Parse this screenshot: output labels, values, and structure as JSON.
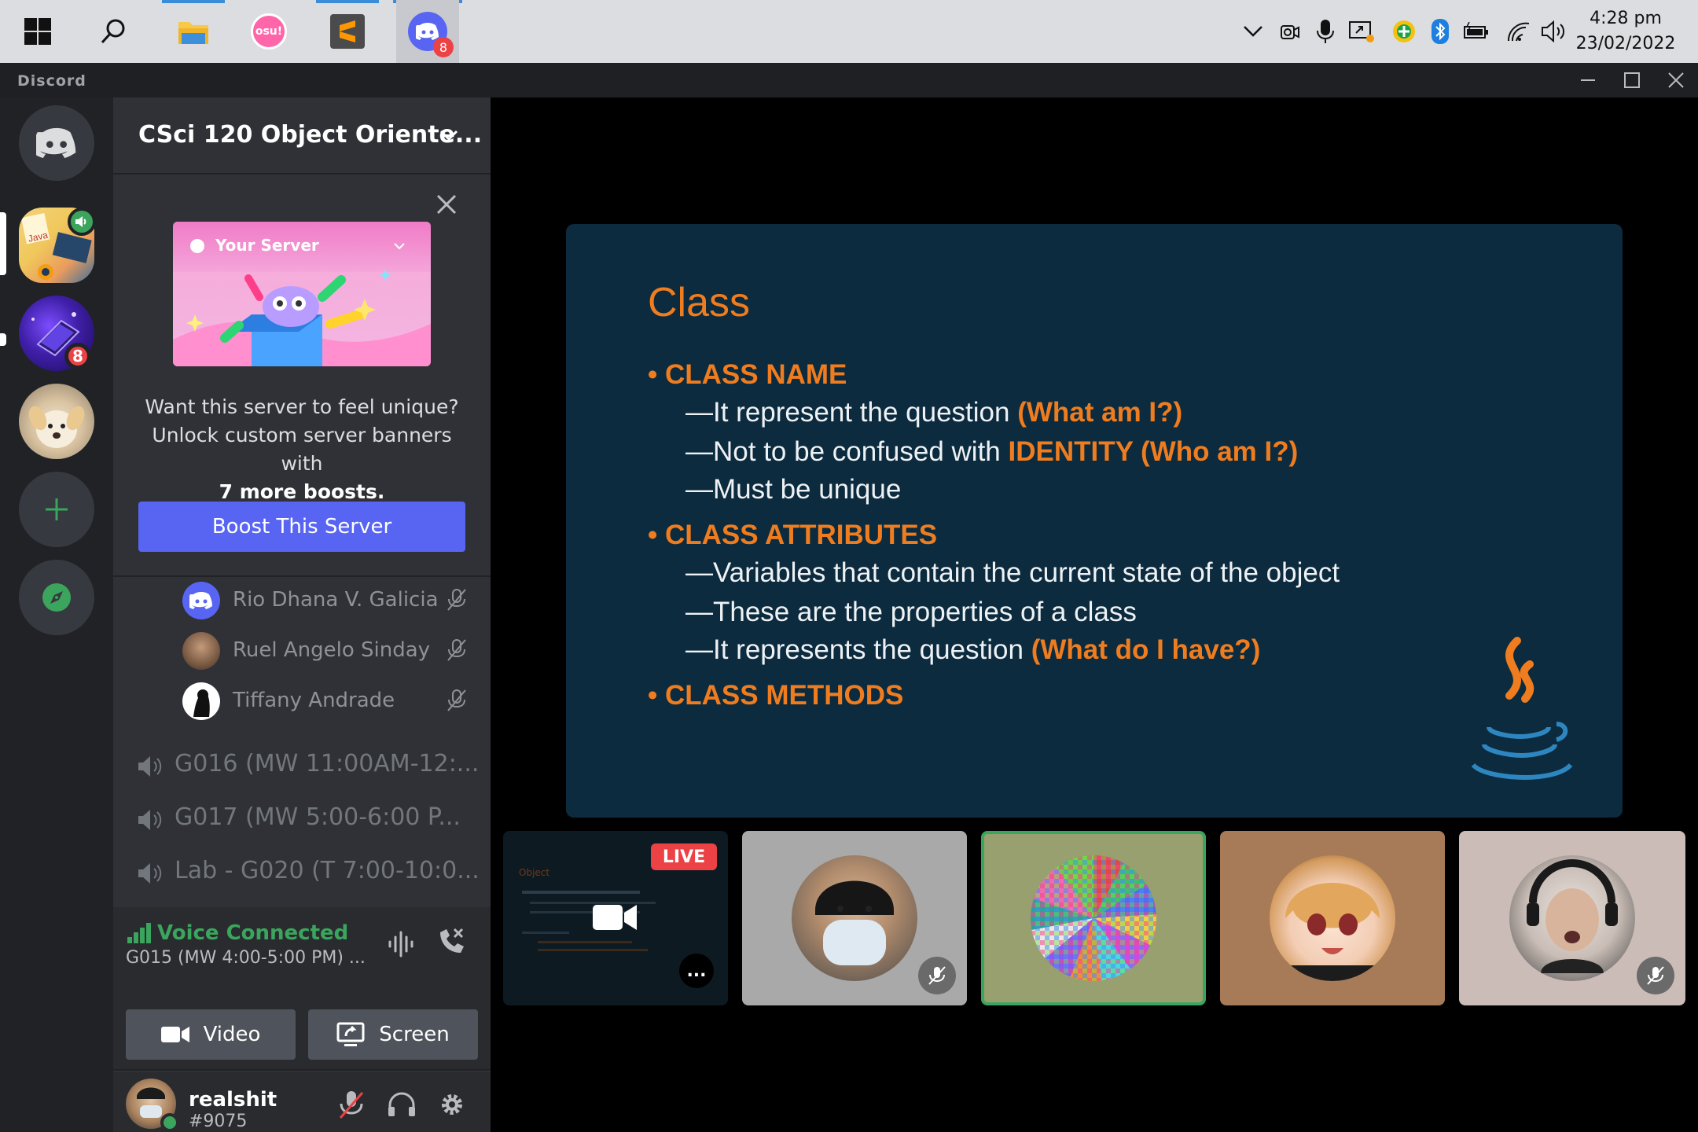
{
  "taskbar": {
    "apps": [
      {
        "icon": "windows-start-icon"
      },
      {
        "icon": "search-icon"
      },
      {
        "icon": "file-explorer-icon"
      },
      {
        "icon": "osu-icon",
        "label": "osu!"
      },
      {
        "icon": "sublime-text-icon"
      },
      {
        "icon": "discord-icon",
        "badge": "8"
      }
    ],
    "tray": [
      "chevron-up-icon",
      "camera-icon",
      "microphone-icon",
      "screen-share-icon",
      "vpn-icon",
      "bluetooth-icon",
      "battery-icon",
      "wifi-icon",
      "volume-icon"
    ],
    "time": "4:28 pm",
    "date": "23/02/2022"
  },
  "window": {
    "app_name": "Discord"
  },
  "servers": [
    {
      "name": "discord-home",
      "icon": "discord-logo-icon"
    },
    {
      "name": "java-server",
      "speaker": true
    },
    {
      "name": "laptop-server",
      "badge": "8"
    },
    {
      "name": "dog-server"
    }
  ],
  "server": {
    "name": "CSci 120 Object Oriente...",
    "boost": {
      "card_title": "Your Server",
      "text1": "Want this server to feel unique?",
      "text2": "Unlock custom server banners with",
      "text3": "7 more boosts.",
      "button": "Boost This Server"
    },
    "members": [
      {
        "name": "Rio Dhana V. Galicia"
      },
      {
        "name": "Ruel Angelo Sinday"
      },
      {
        "name": "Tiffany Andrade"
      }
    ],
    "voice_channels": [
      {
        "name": "G016 (MW 11:00AM-12:..."
      },
      {
        "name": "G017 (MW 5:00-6:00 P..."
      },
      {
        "name": "Lab - G020 (T 7:00-10:0..."
      }
    ]
  },
  "voice": {
    "status": "Voice Connected",
    "channel": "G015 (MW 4:00-5:00 PM) ...",
    "video_label": "Video",
    "screen_label": "Screen"
  },
  "user": {
    "name": "realshit",
    "tag": "#9075"
  },
  "slide": {
    "title": "Class",
    "heading1": "CLASS NAME",
    "l1a": "—It represent the question ",
    "l1a_hl": "(What am I?)",
    "l1b": "—Not to be confused with ",
    "l1b_hl": "IDENTITY (Who am I?)",
    "l1c": "—Must be unique",
    "heading2": "CLASS ATTRIBUTES",
    "l2a": "—Variables that contain the current state of the object",
    "l2b": "—These are the properties of a class",
    "l2c": "—It represents the question ",
    "l2c_hl": "(What do I have?)",
    "heading3": "CLASS METHODS"
  },
  "tiles": {
    "live_label": "LIVE",
    "mini_title": "Object",
    "more_label": "..."
  },
  "colors": {
    "accent": "#5865f2",
    "voice_green": "#3ba55d",
    "slide_orange": "#ef7d1f",
    "live_red": "#ed4245"
  }
}
